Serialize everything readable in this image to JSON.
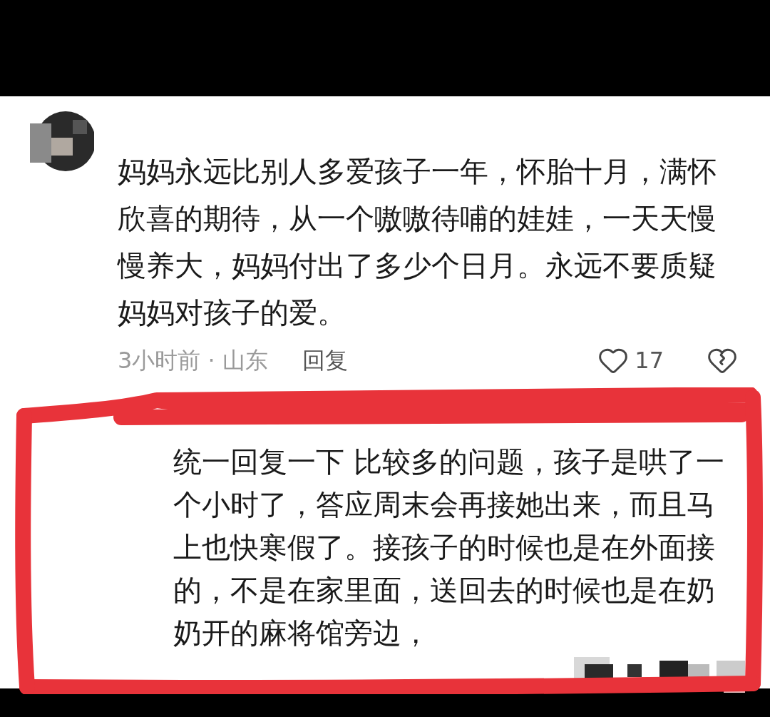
{
  "comment": {
    "text": "妈妈永远比别人多爱孩子一年，怀胎十月，满怀欣喜的期待，从一个嗷嗷待哺的娃娃，一天天慢慢养大，妈妈付出了多少个日月。永远不要质疑妈妈对孩子的爱。",
    "meta": "3小时前 · 山东",
    "reply_action": "回复",
    "likes": "17"
  },
  "reply": {
    "text": "统一回复一下 比较多的问题，孩子是哄了一个小时了，答应周末会再接她出来，而且马上也快寒假了。接孩子的时候也是在外面接的，不是在家里面，送回去的时候也是在奶奶开的麻将馆旁边，"
  }
}
